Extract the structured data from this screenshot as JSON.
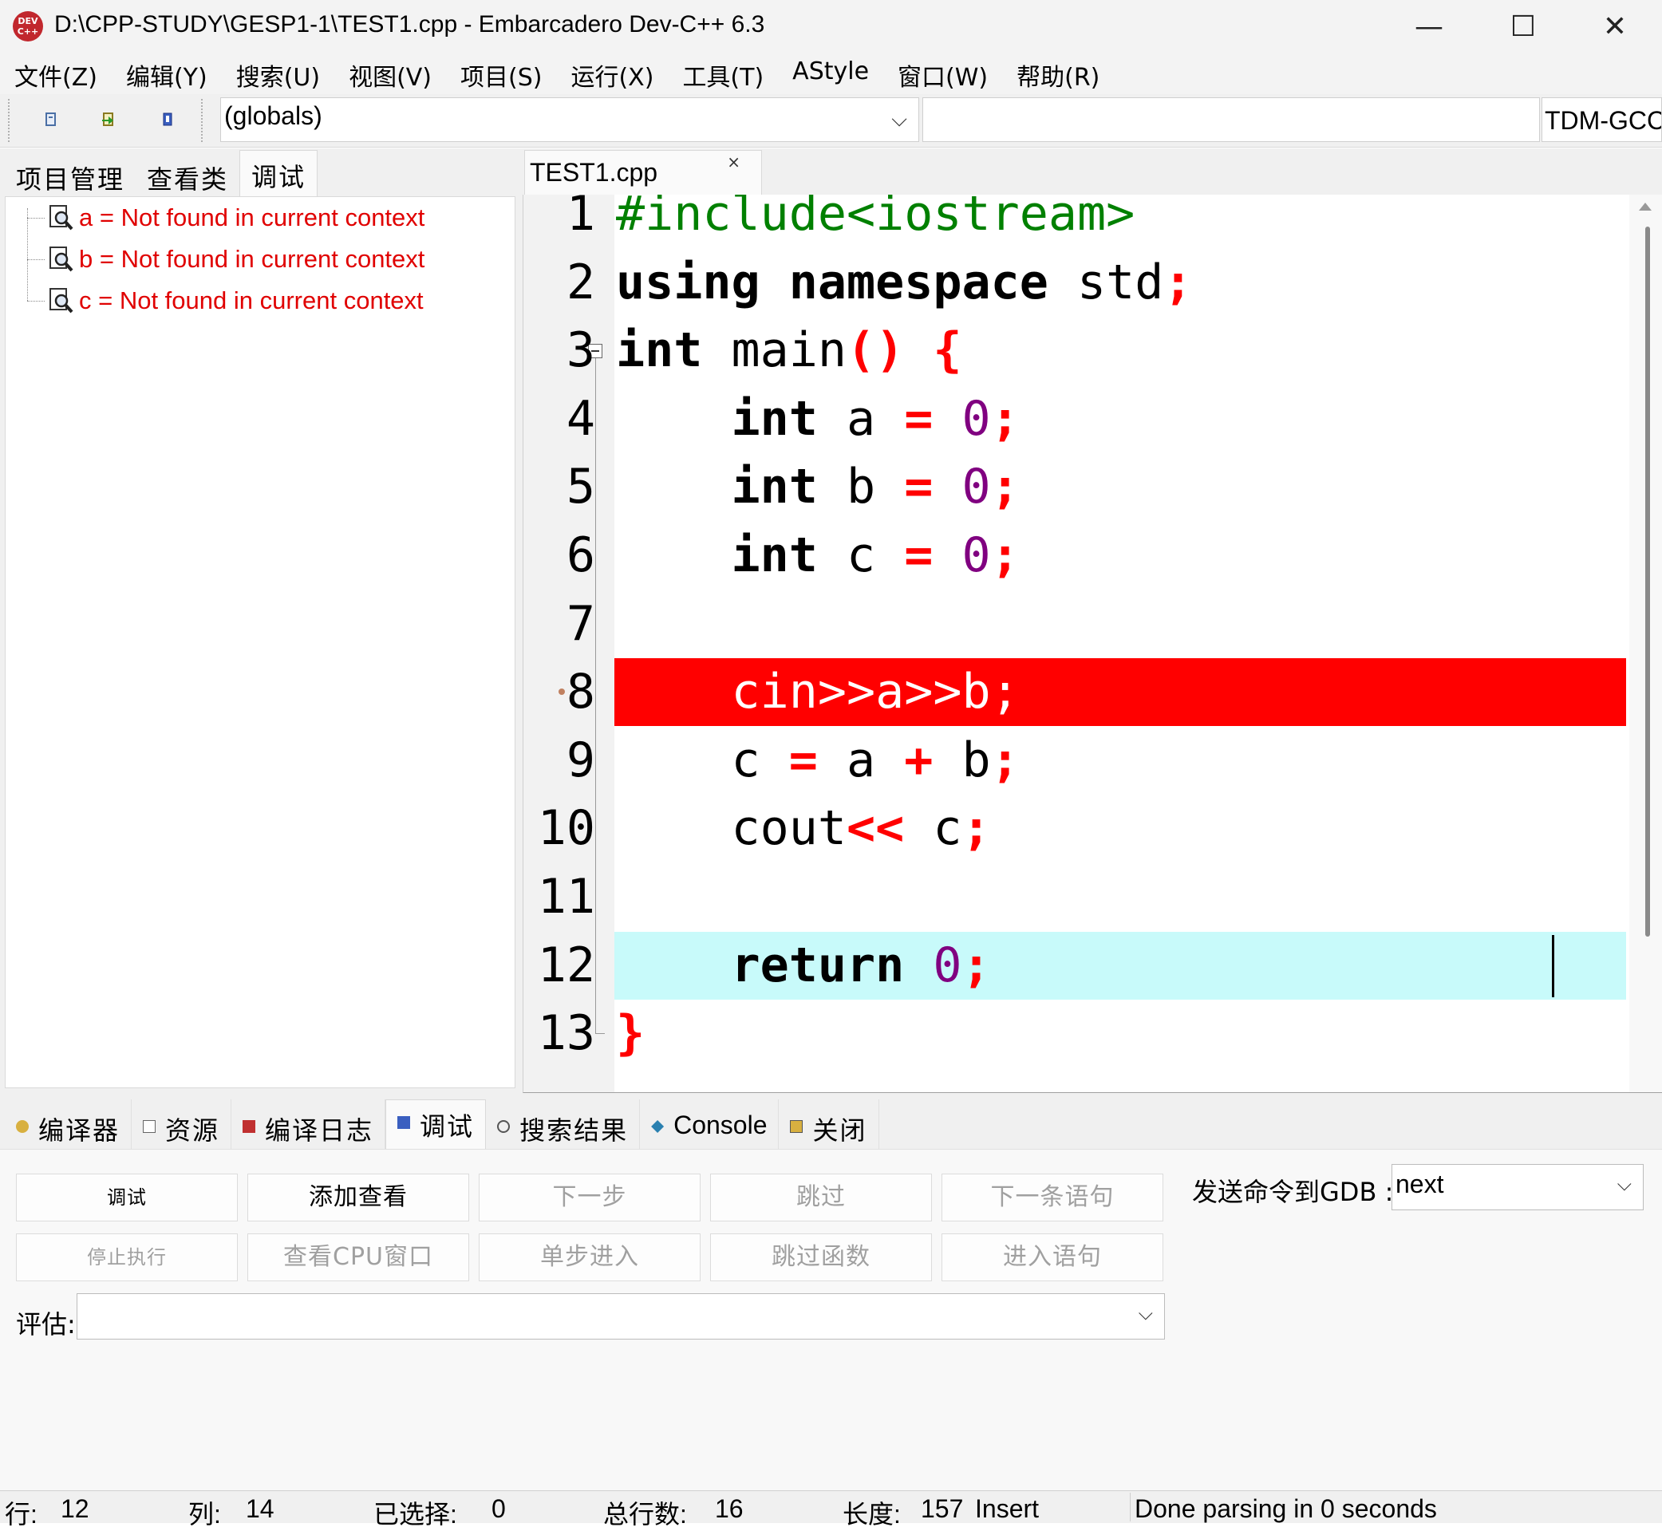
{
  "window": {
    "title": "D:\\CPP-STUDY\\GESP1-1\\TEST1.cpp - Embarcadero Dev-C++ 6.3",
    "app_icon_text": "DEV C++",
    "minimize": "—",
    "maximize": "☐",
    "close": "✕"
  },
  "menu": [
    "文件(Z)",
    "编辑(Y)",
    "搜索(U)",
    "视图(V)",
    "项目(S)",
    "运行(X)",
    "工具(T)",
    "AStyle",
    "窗口(W)",
    "帮助(R)"
  ],
  "toolbar": {
    "scope_value": "(globals)",
    "compiler": "TDM-GCC"
  },
  "left_panel": {
    "tabs": [
      "项目管理",
      "查看类",
      "调试"
    ],
    "active_tab": "调试",
    "watches": [
      {
        "text": "a = Not found in current context"
      },
      {
        "text": "b = Not found in current context"
      },
      {
        "text": "c = Not found in current context"
      }
    ]
  },
  "editor": {
    "tab": "TEST1.cpp",
    "tab_close": "×",
    "breakpoint_line": 8,
    "current_line": 12,
    "line_numbers": [
      "1",
      "2",
      "3",
      "4",
      "5",
      "6",
      "7",
      "8",
      "9",
      "10",
      "11",
      "12",
      "13"
    ],
    "breakpoint_color": "#ff0000",
    "current_line_color": "#c8fafa"
  },
  "bottom_panel": {
    "tabs": [
      {
        "label": "编译器",
        "icon": "compiler-icon"
      },
      {
        "label": "资源",
        "icon": "resource-icon"
      },
      {
        "label": "编译日志",
        "icon": "compile-log-icon"
      },
      {
        "label": "调试",
        "icon": "debug-icon"
      },
      {
        "label": "搜索结果",
        "icon": "search-results-icon"
      },
      {
        "label": "Console",
        "icon": "console-icon"
      },
      {
        "label": "关闭",
        "icon": "close-panel-icon"
      }
    ],
    "active_tab": "调试",
    "buttons": {
      "debug": "调试",
      "add_watch": "添加查看",
      "next_step": "下一步",
      "skip": "跳过",
      "next_statement": "下一条语句",
      "stop": "停止执行",
      "view_cpu": "查看CPU窗口",
      "step_into": "单步进入",
      "skip_function": "跳过函数",
      "into_statement": "进入语句"
    },
    "gdb_label": "发送命令到GDB :",
    "gdb_value": "next",
    "eval_label": "评估:",
    "eval_value": ""
  },
  "status": {
    "row_label": "行:",
    "row": "12",
    "col_label": "列:",
    "col": "14",
    "sel_label": "已选择:",
    "sel": "0",
    "total_label": "总行数:",
    "total": "16",
    "len_label": "长度:",
    "len": "157",
    "mode": "Insert",
    "message": "Done parsing in 0 seconds"
  }
}
